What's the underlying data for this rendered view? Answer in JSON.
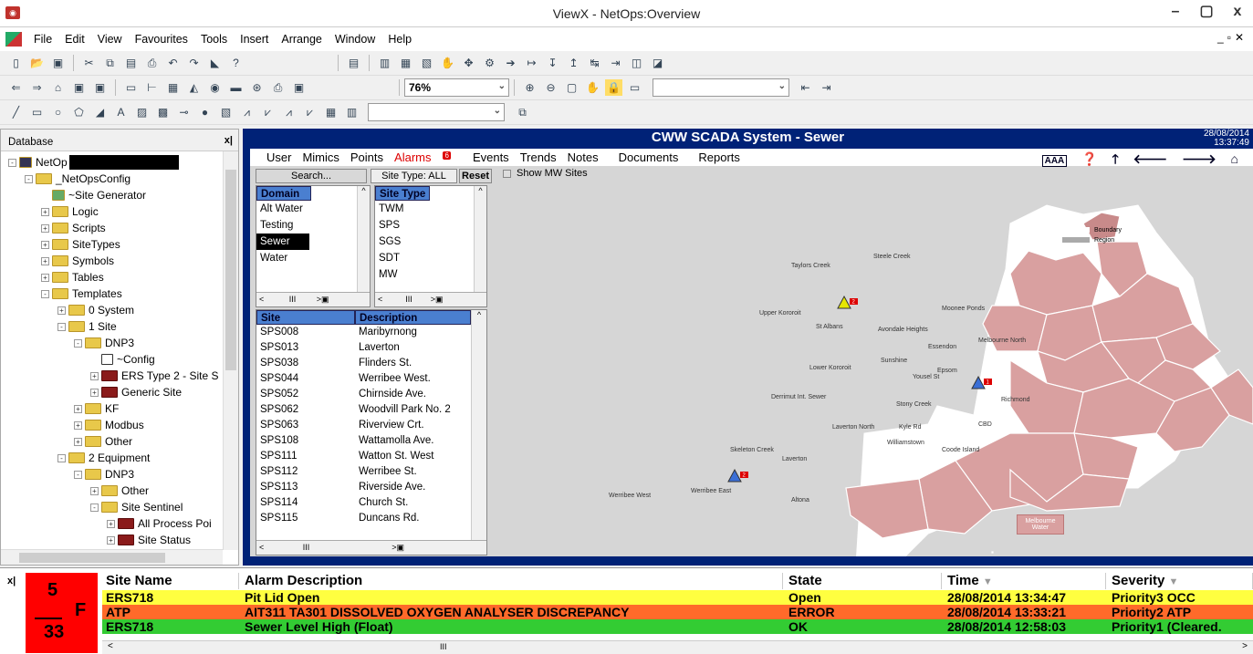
{
  "window": {
    "title": "ViewX - NetOps:Overview"
  },
  "menu": [
    "File",
    "Edit",
    "View",
    "Favourites",
    "Tools",
    "Insert",
    "Arrange",
    "Window",
    "Help"
  ],
  "toolbar": {
    "zoom": "76%"
  },
  "database": {
    "title": "Database",
    "tree": [
      {
        "label": "NetOp",
        "level": 0,
        "exp": "-",
        "icon": "pc"
      },
      {
        "label": "_NetOpsConfig",
        "level": 1,
        "exp": "-",
        "icon": "folder"
      },
      {
        "label": "~Site Generator",
        "level": 2,
        "exp": "",
        "icon": "gen"
      },
      {
        "label": "Logic",
        "level": 2,
        "exp": "+",
        "icon": "folder"
      },
      {
        "label": "Scripts",
        "level": 2,
        "exp": "+",
        "icon": "folder"
      },
      {
        "label": "SiteTypes",
        "level": 2,
        "exp": "+",
        "icon": "folder"
      },
      {
        "label": "Symbols",
        "level": 2,
        "exp": "+",
        "icon": "folder"
      },
      {
        "label": "Tables",
        "level": 2,
        "exp": "+",
        "icon": "folder"
      },
      {
        "label": "Templates",
        "level": 2,
        "exp": "-",
        "icon": "folder"
      },
      {
        "label": "0 System",
        "level": 3,
        "exp": "+",
        "icon": "folder"
      },
      {
        "label": "1 Site",
        "level": 3,
        "exp": "-",
        "icon": "folder"
      },
      {
        "label": "DNP3",
        "level": 4,
        "exp": "-",
        "icon": "folder"
      },
      {
        "label": "~Config",
        "level": 5,
        "exp": "",
        "icon": "script"
      },
      {
        "label": "ERS Type 2 - Site S",
        "level": 5,
        "exp": "+",
        "icon": "red"
      },
      {
        "label": "Generic Site",
        "level": 5,
        "exp": "+",
        "icon": "red"
      },
      {
        "label": "KF",
        "level": 4,
        "exp": "+",
        "icon": "folder"
      },
      {
        "label": "Modbus",
        "level": 4,
        "exp": "+",
        "icon": "folder"
      },
      {
        "label": "Other",
        "level": 4,
        "exp": "+",
        "icon": "folder"
      },
      {
        "label": "2 Equipment",
        "level": 3,
        "exp": "-",
        "icon": "folder"
      },
      {
        "label": "DNP3",
        "level": 4,
        "exp": "-",
        "icon": "folder"
      },
      {
        "label": "Other",
        "level": 5,
        "exp": "+",
        "icon": "folder"
      },
      {
        "label": "Site Sentinel",
        "level": 5,
        "exp": "-",
        "icon": "folder"
      },
      {
        "label": "All Process Poi",
        "level": 6,
        "exp": "+",
        "icon": "red"
      },
      {
        "label": "Site Status",
        "level": 6,
        "exp": "+",
        "icon": "red"
      }
    ]
  },
  "main": {
    "title": "CWW SCADA System - Sewer",
    "date": "28/08/2014",
    "time": "13:37:49",
    "nav": [
      "User",
      "Mimics",
      "Points",
      "Alarms",
      "Events",
      "Trends",
      "Notes",
      "Documents",
      "Reports"
    ],
    "alarms_badge": "6",
    "search_label": "Search...",
    "site_type_label": "Site Type: ALL",
    "reset_label": "Reset",
    "show_mw_label": "Show MW Sites",
    "domain_header": "Domain",
    "domains": [
      "Alt Water",
      "Testing",
      "Sewer",
      "Water"
    ],
    "selected_domain": "Sewer",
    "sitetype_header": "Site Type",
    "site_types": [
      "TWM",
      "SPS",
      "SGS",
      "SDT",
      "MW"
    ],
    "site_col": "Site",
    "desc_col": "Description",
    "sites": [
      [
        "SPS008",
        "Maribyrnong"
      ],
      [
        "SPS013",
        "Laverton"
      ],
      [
        "SPS038",
        "Flinders St."
      ],
      [
        "SPS044",
        "Werribee West."
      ],
      [
        "SPS052",
        "Chirnside Ave."
      ],
      [
        "SPS062",
        "Woodvill Park No. 2"
      ],
      [
        "SPS063",
        "Riverview Crt."
      ],
      [
        "SPS108",
        "Wattamolla Ave."
      ],
      [
        "SPS111",
        "Watton St. West"
      ],
      [
        "SPS112",
        "Werribee St."
      ],
      [
        "SPS113",
        "Riverside Ave."
      ],
      [
        "SPS114",
        "Church St."
      ],
      [
        "SPS115",
        "Duncans Rd."
      ]
    ],
    "map": {
      "legend_boundary": "Boundary",
      "legend_region": "Region",
      "mw_label": "Melbourne Water",
      "regions": [
        "Taylors Creek",
        "Steele Creek",
        "Upper Kororoit",
        "St Albans",
        "Moonee Ponds",
        "Avondale Heights",
        "Essendon",
        "Melbourne North",
        "Lower Kororoit",
        "Sunshine",
        "Epsom",
        "Yousel St",
        "Derrimut Int. Sewer",
        "Stony Creek",
        "Richmond",
        "Laverton North",
        "Kyle Rd",
        "CBD",
        "Williamstown",
        "Coode Island",
        "Skeleton Creek",
        "Laverton",
        "Werribee West",
        "Werribee East",
        "Altona"
      ],
      "markers": [
        {
          "badge": "2",
          "color": "#e6e600"
        },
        {
          "badge": "1",
          "color": "#3b6fd6"
        },
        {
          "badge": "2",
          "color": "#3b6fd6"
        }
      ]
    }
  },
  "alarm": {
    "count_top": "5",
    "count_letter": "F",
    "count_bottom": "33",
    "columns": [
      "Site Name",
      "Alarm Description",
      "State",
      "Time",
      "Severity"
    ],
    "rows": [
      {
        "site": "ERS718",
        "desc": "Pit Lid Open",
        "state": "Open",
        "time": "28/08/2014 13:34:47",
        "severity": "Priority3 OCC",
        "color": "#ffff40"
      },
      {
        "site": "ATP",
        "desc": "AIT311 TA301 DISSOLVED OXYGEN ANALYSER DISCREPANCY",
        "state": "ERROR",
        "time": "28/08/2014 13:33:21",
        "severity": "Priority2 ATP",
        "color": "#ff6a2a"
      },
      {
        "site": "ERS718",
        "desc": "Sewer Level High (Float)",
        "state": "OK",
        "time": "28/08/2014 12:58:03",
        "severity": "Priority1  (Cleared.",
        "color": "#33cc33"
      }
    ]
  }
}
